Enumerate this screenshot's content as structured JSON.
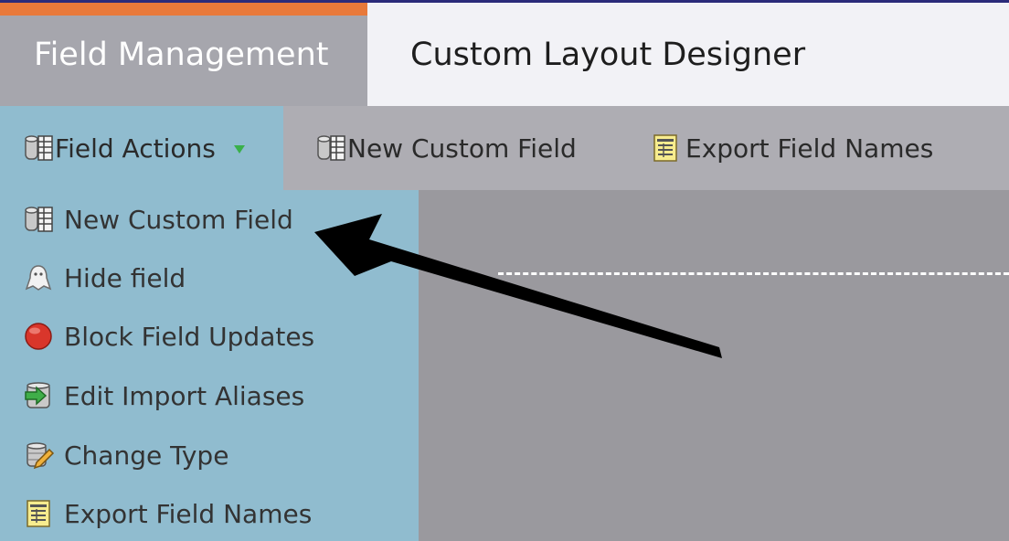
{
  "tabs": [
    {
      "label": "Field Management",
      "active": true
    },
    {
      "label": "Custom Layout Designer",
      "active": false
    }
  ],
  "toolbar": {
    "field_actions_label": "Field Actions",
    "new_custom_field_label": "New Custom Field",
    "export_field_names_label": "Export Field Names"
  },
  "menu": {
    "items": [
      {
        "label": "New Custom Field",
        "icon": "database-table-icon"
      },
      {
        "label": "Hide field",
        "icon": "ghost-icon"
      },
      {
        "label": "Block Field Updates",
        "icon": "red-circle-icon"
      },
      {
        "label": "Edit Import Aliases",
        "icon": "import-arrow-icon"
      },
      {
        "label": "Change Type",
        "icon": "database-pencil-icon"
      },
      {
        "label": "Export Field Names",
        "icon": "document-icon"
      }
    ]
  },
  "colors": {
    "accent_orange": "#e8793a",
    "menu_bg": "#90bccf",
    "active_tab_bg": "#a6a6ad",
    "content_bg": "#9a999e"
  }
}
